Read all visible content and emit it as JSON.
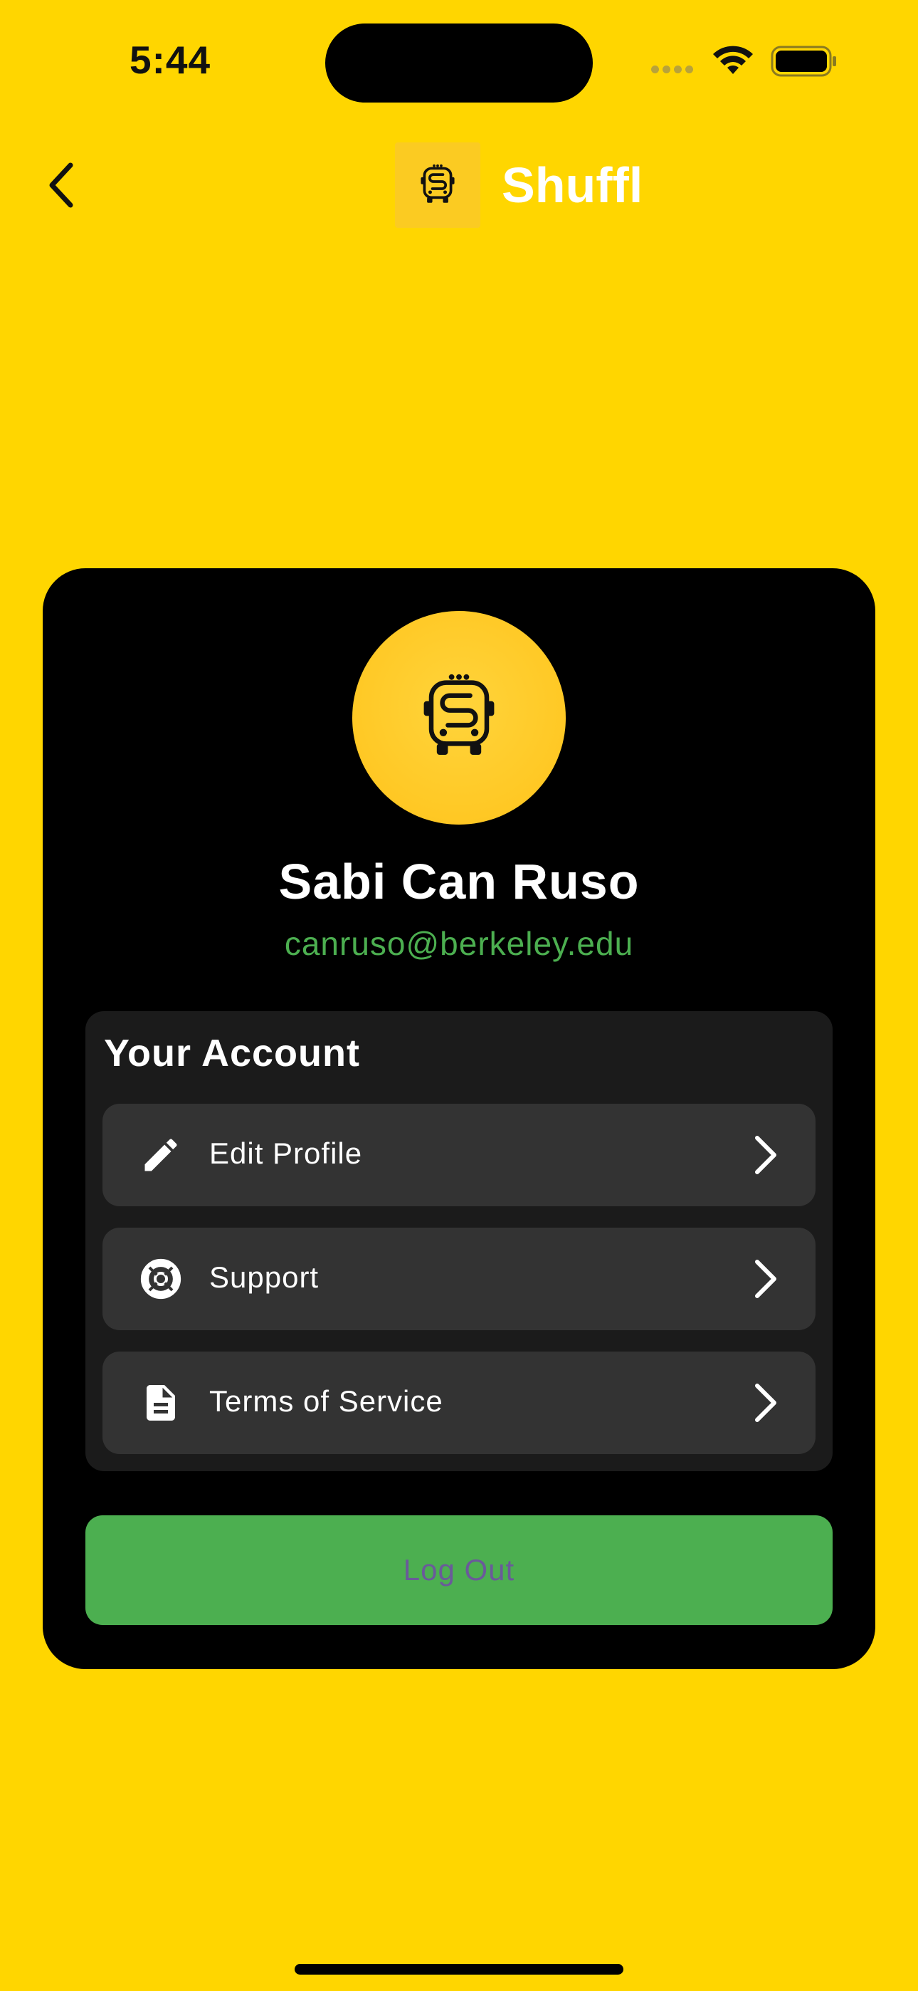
{
  "status_bar": {
    "time": "5:44"
  },
  "header": {
    "title": "Shuffl",
    "logo_icon": "school-bus-icon",
    "back_icon": "chevron-left-icon"
  },
  "profile": {
    "name": "Sabi Can Ruso",
    "email": "canruso@berkeley.edu",
    "avatar_icon": "school-bus-icon"
  },
  "account": {
    "title": "Your Account",
    "items": [
      {
        "label": "Edit Profile",
        "icon": "pencil-icon"
      },
      {
        "label": "Support",
        "icon": "lifebuoy-icon"
      },
      {
        "label": "Terms of Service",
        "icon": "document-icon"
      }
    ]
  },
  "logout": {
    "label": "Log Out"
  },
  "colors": {
    "background": "#FFD600",
    "card": "#000000",
    "panel": "#1B1B1B",
    "item": "#333333",
    "accent_green": "#4CAF50",
    "logout_text": "#6A5A9A"
  }
}
